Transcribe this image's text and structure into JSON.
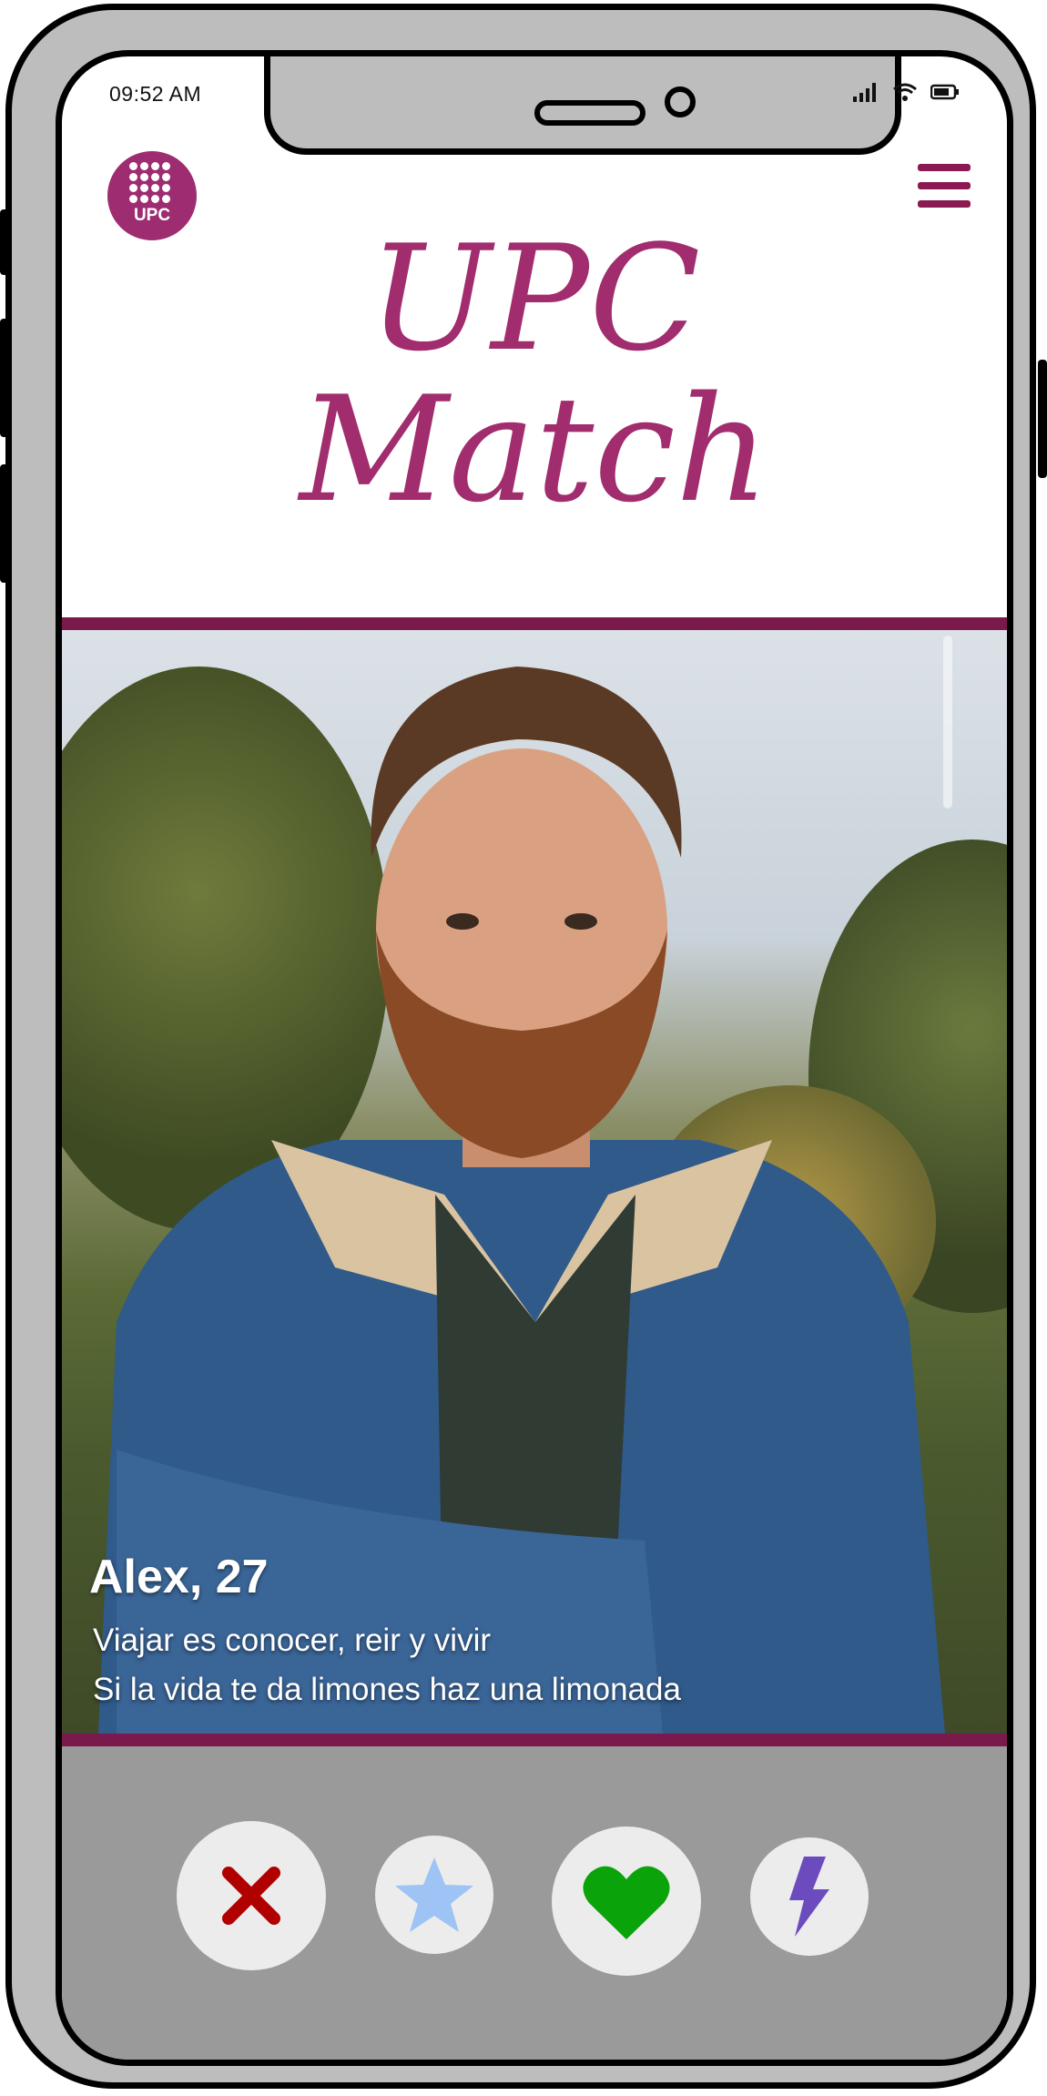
{
  "status_bar": {
    "time": "09:52 AM"
  },
  "header": {
    "logo_text": "UPC",
    "title_line1": "UPC",
    "title_line2": "Match"
  },
  "profile": {
    "name_age": "Alex, 27",
    "bio_line1": "Viajar es conocer, reir y vivir",
    "bio_line2": "Si la vida te da limones haz una limonada"
  },
  "actions": [
    {
      "icon": "close-icon",
      "color": "#b00000"
    },
    {
      "icon": "star-icon",
      "color": "#9ec3f5"
    },
    {
      "icon": "heart-icon",
      "color": "#0aa30a"
    },
    {
      "icon": "bolt-icon",
      "color": "#6c4bbf"
    }
  ],
  "colors": {
    "brand": "#9e2c70",
    "divider": "#7a1a4c"
  }
}
